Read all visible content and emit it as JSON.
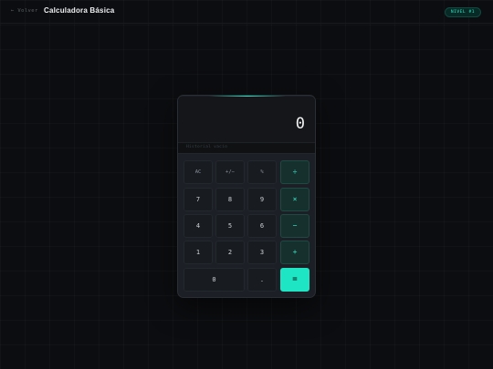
{
  "header": {
    "back_label": "← Volver",
    "title": "Calculadora Básica",
    "level_badge": "NIVEL #1"
  },
  "calculator": {
    "display_value": "0",
    "expression_placeholder": "Historial vacío",
    "keys": {
      "clear": "AC",
      "sign": "+/−",
      "percent": "%",
      "divide": "÷",
      "seven": "7",
      "eight": "8",
      "nine": "9",
      "multiply": "×",
      "four": "4",
      "five": "5",
      "six": "6",
      "minus": "−",
      "one": "1",
      "two": "2",
      "three": "3",
      "plus": "+",
      "zero": "0",
      "decimal": ".",
      "equals": "="
    }
  },
  "colors": {
    "accent": "#1ee6c4",
    "background": "#0c0d10",
    "panel": "#1c1f25"
  }
}
